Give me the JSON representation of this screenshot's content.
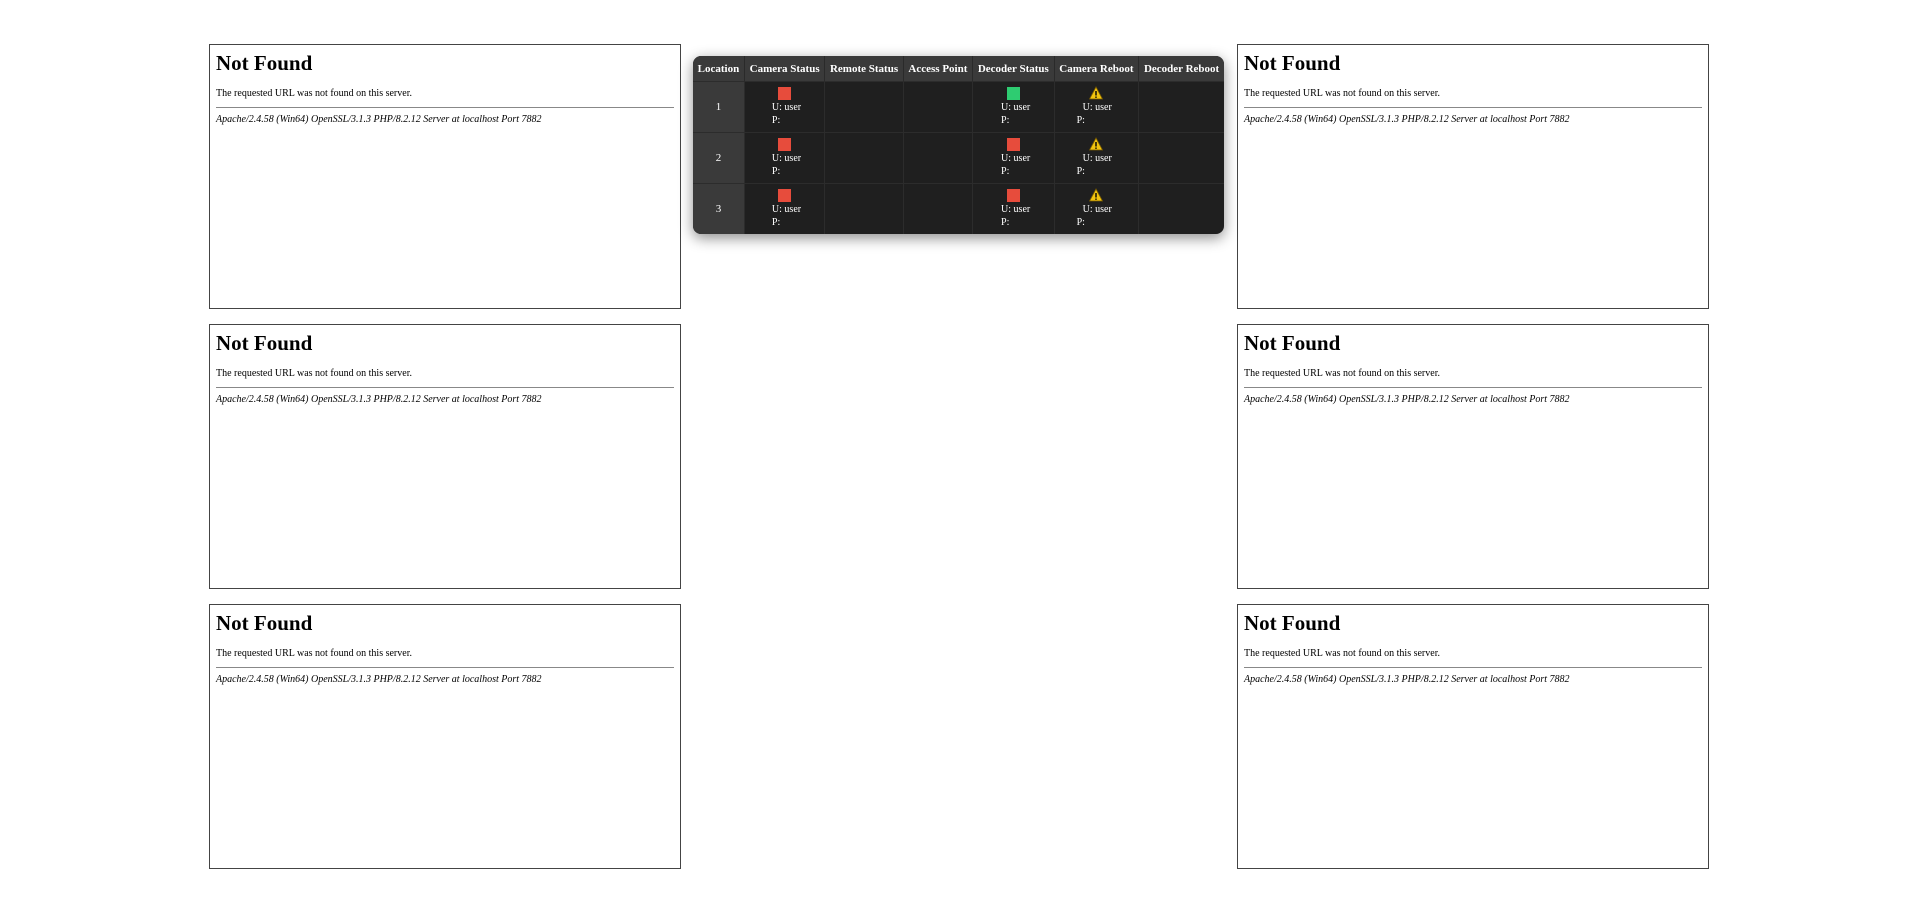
{
  "colors": {
    "status_red": "#e74c3c",
    "status_green": "#2ecc71",
    "warning_yellow": "#f1c40f"
  },
  "error_page": {
    "title": "Not Found",
    "message": "The requested URL was not found on this server.",
    "server_signature": "Apache/2.4.58 (Win64) OpenSSL/3.1.3 PHP/8.2.12 Server at localhost Port 7882"
  },
  "status_table": {
    "headers": [
      "Location",
      "Camera Status",
      "Remote Status",
      "Access Point",
      "Decoder Status",
      "Camera Reboot",
      "Decoder Reboot"
    ],
    "rows": [
      {
        "location": "1",
        "camera": {
          "status": "red",
          "user": "U: user",
          "pass": "P:"
        },
        "decoder": {
          "status": "green",
          "user": "U: user",
          "pass": "P:"
        },
        "camera_reboot": {
          "icon": "warning-icon",
          "user": "U: user",
          "pass": "P:"
        }
      },
      {
        "location": "2",
        "camera": {
          "status": "red",
          "user": "U: user",
          "pass": "P:"
        },
        "decoder": {
          "status": "red",
          "user": "U: user",
          "pass": "P:"
        },
        "camera_reboot": {
          "icon": "warning-icon",
          "user": "U: user",
          "pass": "P:"
        }
      },
      {
        "location": "3",
        "camera": {
          "status": "red",
          "user": "U: user",
          "pass": "P:"
        },
        "decoder": {
          "status": "red",
          "user": "U: user",
          "pass": "P:"
        },
        "camera_reboot": {
          "icon": "warning-icon",
          "user": "U: user",
          "pass": "P:"
        }
      }
    ]
  }
}
